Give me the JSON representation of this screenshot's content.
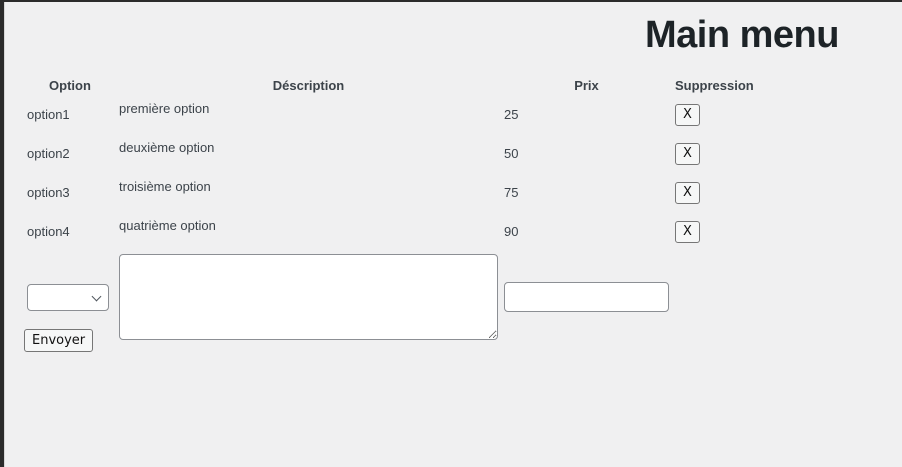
{
  "page": {
    "title": "Main menu"
  },
  "table": {
    "headers": {
      "option": "Option",
      "description": "Déscription",
      "prix": "Prix",
      "suppression": "Suppression"
    },
    "rows": [
      {
        "option": "option1",
        "description": "première option",
        "prix": "25",
        "delete_label": "X"
      },
      {
        "option": "option2",
        "description": "deuxième option",
        "prix": "50",
        "delete_label": "X"
      },
      {
        "option": "option3",
        "description": "troisième option",
        "prix": "75",
        "delete_label": "X"
      },
      {
        "option": "option4",
        "description": "quatrième option",
        "prix": "90",
        "delete_label": "X"
      }
    ]
  },
  "form": {
    "option_select_value": "",
    "description_value": "",
    "prix_value": "",
    "submit_label": "Envoyer"
  }
}
